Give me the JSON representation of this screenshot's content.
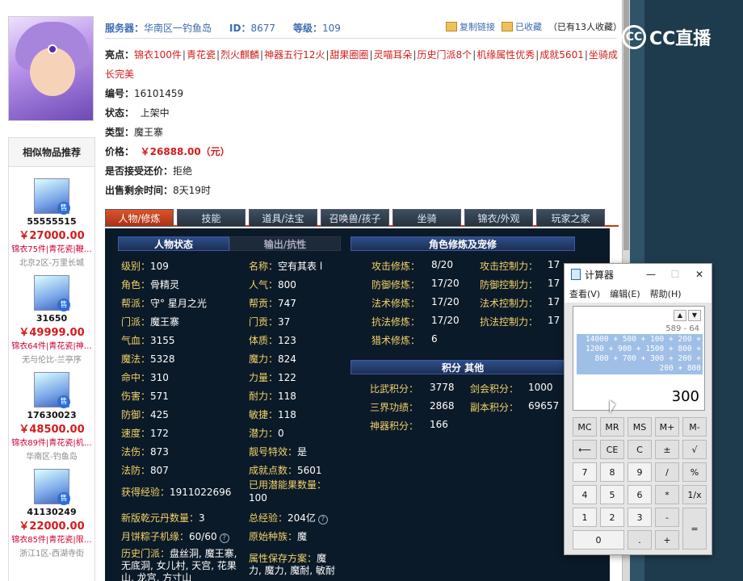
{
  "header": {
    "server_label": "服务器：",
    "server_value": "华南区一钓鱼岛",
    "id_label": "ID：",
    "id_value": "8677",
    "level_label": "等级：",
    "level_value": "109",
    "copy_link": "复制链接",
    "favorited": "已收藏",
    "fav_count": "（已有13人收藏）"
  },
  "brand": {
    "logo_text": "CC",
    "name": "CC直播"
  },
  "details": {
    "highlights_label": "亮点：",
    "highlights": [
      "锦衣100件",
      "青花瓷",
      "烈火麒麟",
      "神器五行12火",
      "甜果圈圈",
      "灵喵耳朵",
      "历史门派8个",
      "机缘属性优秀",
      "成就5601",
      "坐骑成长完美"
    ],
    "serial_label": "编号：",
    "serial_value": "16101459",
    "status_label": "状态：",
    "status_value": "上架中",
    "type_label": "类型：",
    "type_value": "魔王寨",
    "price_label": "价格：",
    "price_value": "￥26888.00（元）",
    "counter_label": "是否接受还价：",
    "counter_value": "拒绝",
    "time_label": "出售剩余时间：",
    "time_value": "8天19时"
  },
  "similar": {
    "title": "相似物品推荐",
    "items": [
      {
        "id": "55555515",
        "price": "￥27000.00",
        "desc": "锦衣75件|青花瓷|鞭…",
        "server": "北京2区-万里长城"
      },
      {
        "id": "31650",
        "price": "￥49999.00",
        "desc": "锦衣64件|青花瓷|神…",
        "server": "无与伦比-兰亭序"
      },
      {
        "id": "17630023",
        "price": "￥48500.00",
        "desc": "锦衣89件|青花瓷|机…",
        "server": "华南区-钓鱼岛"
      },
      {
        "id": "41130249",
        "price": "￥22000.00",
        "desc": "锦衣85件|青花瓷|限…",
        "server": "浙江1区-西湖寺街"
      }
    ],
    "tag": "售"
  },
  "tabs": [
    "人物/修炼",
    "技能",
    "道具/法宝",
    "召唤兽/孩子",
    "坐骑",
    "锦衣/外观",
    "玩家之家"
  ],
  "game": {
    "hdr_status": "人物状态",
    "hdr_output": "输出/抗性",
    "hdr_cultivation": "角色修炼及宠修",
    "hdr_points": "积分  其他",
    "left_col": [
      {
        "k": "级别：",
        "v": "109"
      },
      {
        "k": "角色：",
        "v": "骨精灵"
      },
      {
        "k": "帮派：",
        "v": "守° 星月之光"
      },
      {
        "k": "门派：",
        "v": "魔王寨"
      },
      {
        "k": "气血：",
        "v": "3155"
      },
      {
        "k": "魔法：",
        "v": "5328"
      },
      {
        "k": "命中：",
        "v": "310"
      },
      {
        "k": "伤害：",
        "v": "571"
      },
      {
        "k": "防御：",
        "v": "425"
      },
      {
        "k": "速度：",
        "v": "172"
      },
      {
        "k": "法伤：",
        "v": "873"
      },
      {
        "k": "法防：",
        "v": "807"
      }
    ],
    "mid_col": [
      {
        "k": "名称：",
        "v": "空有其表 l"
      },
      {
        "k": "人气：",
        "v": "800"
      },
      {
        "k": "帮贡：",
        "v": "747"
      },
      {
        "k": "门贡：",
        "v": "37"
      },
      {
        "k": "体质：",
        "v": "123"
      },
      {
        "k": "魔力：",
        "v": "824"
      },
      {
        "k": "力量：",
        "v": "122"
      },
      {
        "k": "耐力：",
        "v": "118"
      },
      {
        "k": "敏捷：",
        "v": "118"
      },
      {
        "k": "潜力：",
        "v": "0"
      },
      {
        "k": "靓号特效：",
        "v": "是"
      },
      {
        "k": "成就点数：",
        "v": "5601"
      }
    ],
    "cult_left": [
      {
        "k": "攻击修炼：",
        "v": "8/20"
      },
      {
        "k": "防御修炼：",
        "v": "17/20"
      },
      {
        "k": "法术修炼：",
        "v": "17/20"
      },
      {
        "k": "抗法修炼：",
        "v": "17/20"
      },
      {
        "k": "猎术修炼：",
        "v": "6"
      }
    ],
    "cult_right": [
      {
        "k": "攻击控制力：",
        "v": "17"
      },
      {
        "k": "防御控制力：",
        "v": "17"
      },
      {
        "k": "法术控制力：",
        "v": "17"
      },
      {
        "k": "抗法控制力：",
        "v": "17"
      }
    ],
    "points_left": [
      {
        "k": "比武积分：",
        "v": "3778"
      },
      {
        "k": "三界功绩：",
        "v": "2868"
      },
      {
        "k": "神器积分：",
        "v": "166"
      }
    ],
    "points_right": [
      {
        "k": "剑会积分：",
        "v": "1000"
      },
      {
        "k": "副本积分：",
        "v": "69657"
      }
    ],
    "exp_label": "获得经验：",
    "exp_value": "1911022696",
    "potential_label": "已用潜能果数量：",
    "potential_value": "100",
    "qiankun_label": "新版乾元丹数量：",
    "qiankun_value": "3",
    "total_exp_label": "总经验：",
    "total_exp_value": "204亿",
    "mooncake_label": "月饼粽子机缘：",
    "mooncake_value": "60/60",
    "race_label": "原始种族：",
    "race_value": "魔",
    "history_label": "历史门派：",
    "history_value": "盘丝洞, 魔王寨, 无底洞, 女儿村, 天宫, 花果山, 龙宫, 方寸山",
    "attr_label": "属性保存方案：",
    "attr_value": "魔力, 魔力, 魔耐, 敏耐"
  },
  "calculator": {
    "title": "计算器",
    "menu": [
      "查看(V)",
      "编辑(E)",
      "帮助(H)"
    ],
    "history": "589 - 64",
    "expression": "14000 + 500 + 100 + 200 + 1200 + 900 + 1500 + 800 + 800 + 700 + 300 + 200 + 200 + 800",
    "result": "300",
    "keys": [
      "MC",
      "MR",
      "MS",
      "M+",
      "M-",
      "⟵",
      "CE",
      "C",
      "±",
      "√",
      "7",
      "8",
      "9",
      "/",
      "%",
      "4",
      "5",
      "6",
      "*",
      "1/x",
      "1",
      "2",
      "3",
      "-",
      "=",
      "0",
      ".",
      "+"
    ]
  }
}
